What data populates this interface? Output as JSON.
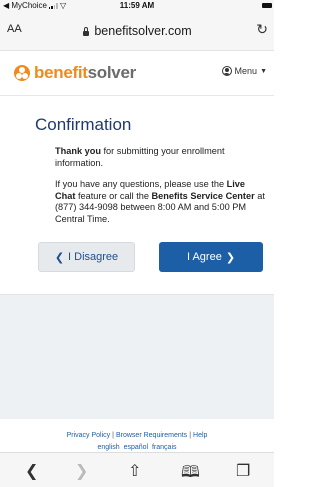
{
  "status_bar": {
    "carrier": "◀ MyChoice",
    "time": "11:59 AM"
  },
  "browser": {
    "text_size_button": "AA",
    "url": "benefitsolver.com",
    "reload_icon": "reload-icon"
  },
  "site_header": {
    "logo": {
      "part1": "benefit",
      "part2": "solver"
    },
    "menu_label": "Menu"
  },
  "page": {
    "title": "Confirmation",
    "para1": {
      "bold": "Thank you",
      "rest": " for submitting your enrollment information."
    },
    "para2": {
      "text1": "If you have any questions, please use the ",
      "bold1": "Live Chat",
      "text2": " feature or call the ",
      "bold2": "Benefits Service Center",
      "text3": " at (877) 344-9098 between 8:00 AM and 5:00 PM Central Time."
    },
    "disagree_button": "I Disagree",
    "agree_button": "I Agree"
  },
  "footer": {
    "privacy": "Privacy Policy",
    "browser_req": "Browser Requirements",
    "help": "Help",
    "languages": [
      "english",
      "español",
      "français"
    ]
  },
  "colors": {
    "brand_orange": "#f08a1c",
    "primary_blue": "#1d5fa6",
    "title_blue": "#1f3a6e"
  }
}
